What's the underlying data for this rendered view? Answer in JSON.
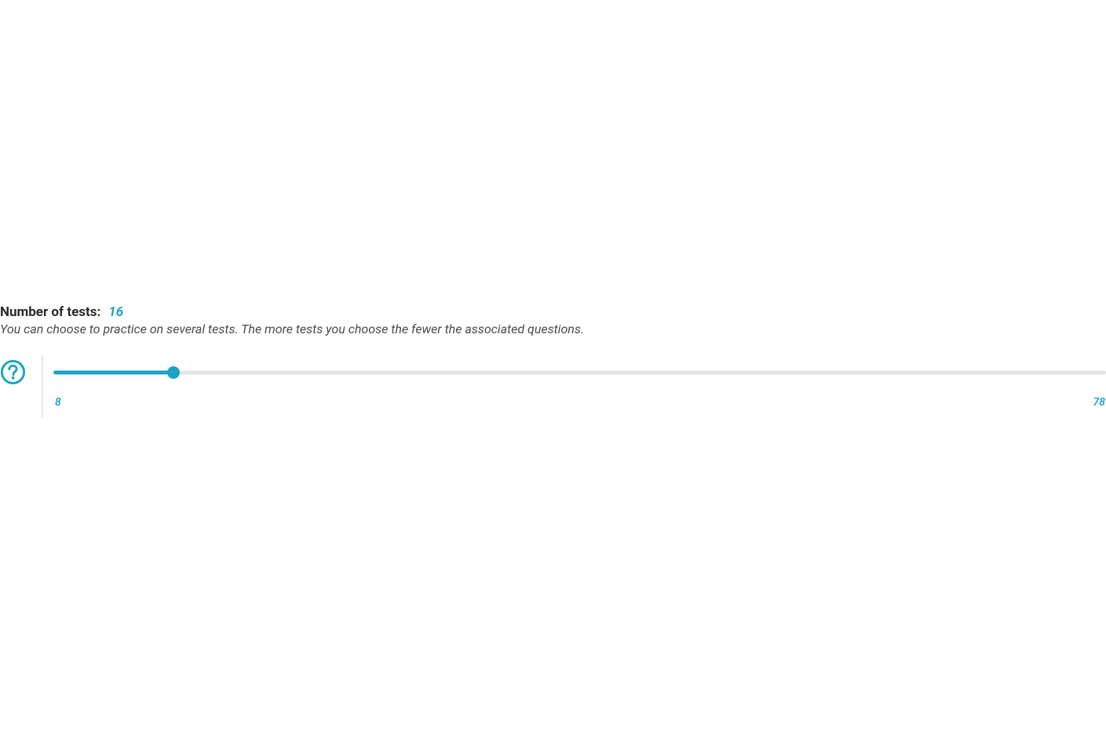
{
  "heading": {
    "label": "Number of tests:",
    "value": "16"
  },
  "description": "You can choose to practice on several tests. The more tests you choose the fewer the associated questions.",
  "slider": {
    "min": 8,
    "max": 78,
    "value": 16,
    "min_label": "8",
    "max_label": "78"
  },
  "colors": {
    "accent": "#1ba3c6",
    "text_dark": "#2b2b2b",
    "text_muted": "#4a4a4a",
    "track_bg": "#e3e3e3",
    "divider": "#e5e5e5"
  }
}
